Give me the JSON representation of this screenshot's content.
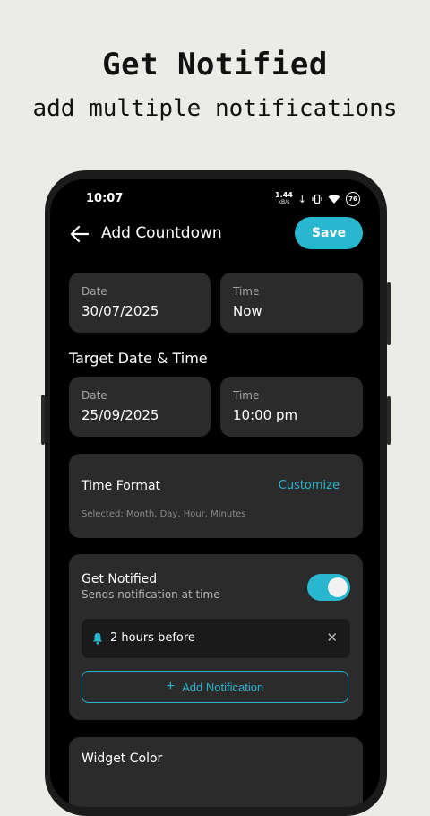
{
  "promo": {
    "title": "Get Notified",
    "subtitle": "add multiple notifications"
  },
  "status_bar": {
    "time": "10:07",
    "net_speed": "1.44",
    "net_unit": "kB/s",
    "battery": "76"
  },
  "app_bar": {
    "title": "Add Countdown",
    "save_label": "Save"
  },
  "start": {
    "date_label": "Date",
    "date_value": "30/07/2025",
    "time_label": "Time",
    "time_value": "Now"
  },
  "target": {
    "section_title": "Target Date & Time",
    "date_label": "Date",
    "date_value": "25/09/2025",
    "time_label": "Time",
    "time_value": "10:00 pm"
  },
  "time_format": {
    "title": "Time Format",
    "customize_label": "Customize",
    "selected": "Selected: Month, Day, Hour, Minutes"
  },
  "notifications": {
    "title": "Get Notified",
    "subtitle": "Sends notification at time",
    "enabled": true,
    "items": [
      {
        "label": "2 hours before"
      }
    ],
    "add_label": "Add Notification"
  },
  "widget": {
    "title": "Widget Color"
  },
  "colors": {
    "accent": "#29b6cf",
    "card": "#2b2b2b",
    "screen_bg": "#000000",
    "page_bg": "#ebebe7"
  }
}
